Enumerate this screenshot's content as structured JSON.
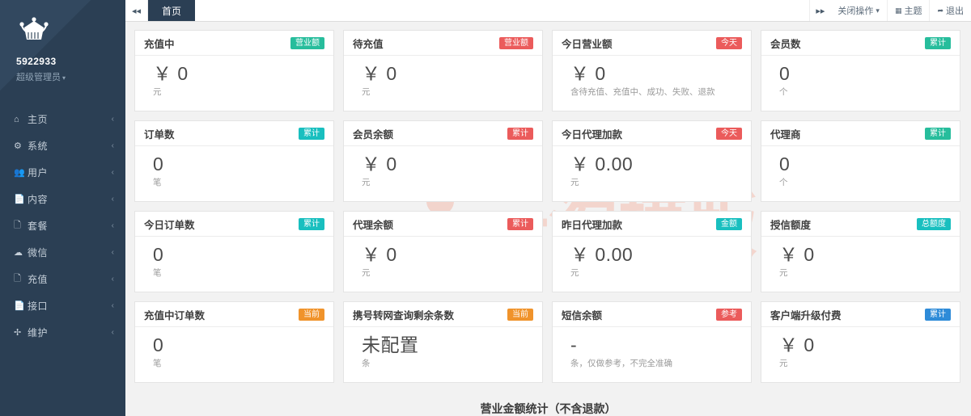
{
  "sidebar": {
    "profile": {
      "name": "5922933",
      "role": "超级管理员",
      "caret": "▾",
      "logo_icon": "crown-logo-icon"
    },
    "items": [
      {
        "label": "主页",
        "icon": "home-icon",
        "arrow": "‹"
      },
      {
        "label": "系统",
        "icon": "gears-icon",
        "arrow": "‹"
      },
      {
        "label": "用户",
        "icon": "users-icon",
        "arrow": "‹"
      },
      {
        "label": "内容",
        "icon": "file-icon",
        "arrow": "‹"
      },
      {
        "label": "套餐",
        "icon": "package-icon",
        "arrow": "‹"
      },
      {
        "label": "微信",
        "icon": "wechat-icon",
        "arrow": "‹"
      },
      {
        "label": "充值",
        "icon": "recharge-icon",
        "arrow": "‹"
      },
      {
        "label": "接口",
        "icon": "api-icon",
        "arrow": "‹"
      },
      {
        "label": "维护",
        "icon": "wrench-icon",
        "arrow": "‹"
      }
    ]
  },
  "topbar": {
    "collapse_icon": "collapse-left-icon",
    "scroll_icon": "scroll-right-icon",
    "tabs": [
      {
        "label": "首页",
        "active": true
      }
    ],
    "actions": [
      {
        "label": "关闭操作",
        "icon": "caret-down-icon",
        "caret": "▾"
      },
      {
        "label": "主题",
        "icon": "theme-icon"
      },
      {
        "label": "退出",
        "icon": "logout-icon"
      }
    ]
  },
  "watermark": {
    "text": "一淘模版",
    "color": "#f6d5cc"
  },
  "cards": [
    {
      "title": "充值中",
      "badge": "营业额",
      "badge_color": "green",
      "currency": "￥",
      "value": "0",
      "unit": "元"
    },
    {
      "title": "待充值",
      "badge": "营业额",
      "badge_color": "red",
      "currency": "￥",
      "value": "0",
      "unit": "元"
    },
    {
      "title": "今日营业额",
      "badge": "今天",
      "badge_color": "red",
      "currency": "￥",
      "value": "0",
      "unit": "含待充值、充值中、成功、失败、退款"
    },
    {
      "title": "会员数",
      "badge": "累计",
      "badge_color": "green",
      "currency": "",
      "value": "0",
      "unit": "个"
    },
    {
      "title": "订单数",
      "badge": "累计",
      "badge_color": "teal",
      "currency": "",
      "value": "0",
      "unit": "笔"
    },
    {
      "title": "会员余额",
      "badge": "累计",
      "badge_color": "red",
      "currency": "￥",
      "value": "0",
      "unit": "元"
    },
    {
      "title": "今日代理加款",
      "badge": "今天",
      "badge_color": "red",
      "currency": "￥",
      "value": "0.00",
      "unit": "元"
    },
    {
      "title": "代理商",
      "badge": "累计",
      "badge_color": "green",
      "currency": "",
      "value": "0",
      "unit": "个"
    },
    {
      "title": "今日订单数",
      "badge": "累计",
      "badge_color": "teal",
      "currency": "",
      "value": "0",
      "unit": "笔"
    },
    {
      "title": "代理余额",
      "badge": "累计",
      "badge_color": "red",
      "currency": "￥",
      "value": "0",
      "unit": "元"
    },
    {
      "title": "昨日代理加款",
      "badge": "金额",
      "badge_color": "teal",
      "currency": "￥",
      "value": "0.00",
      "unit": "元"
    },
    {
      "title": "授信额度",
      "badge": "总额度",
      "badge_color": "teal",
      "currency": "￥",
      "value": "0",
      "unit": "元"
    },
    {
      "title": "充值中订单数",
      "badge": "当前",
      "badge_color": "orange",
      "currency": "",
      "value": "0",
      "unit": "笔"
    },
    {
      "title": "携号转网查询剩余条数",
      "badge": "当前",
      "badge_color": "orange",
      "currency": "",
      "value": "未配置",
      "unit": "条"
    },
    {
      "title": "短信余额",
      "badge": "参考",
      "badge_color": "red",
      "currency": "",
      "value": "-",
      "unit": "条，仅做参考，不完全准确"
    },
    {
      "title": "客户端升级付费",
      "badge": "累计",
      "badge_color": "blue",
      "currency": "￥",
      "value": "0",
      "unit": "元"
    }
  ],
  "section": {
    "title": "营业金额统计（不含退款）"
  }
}
